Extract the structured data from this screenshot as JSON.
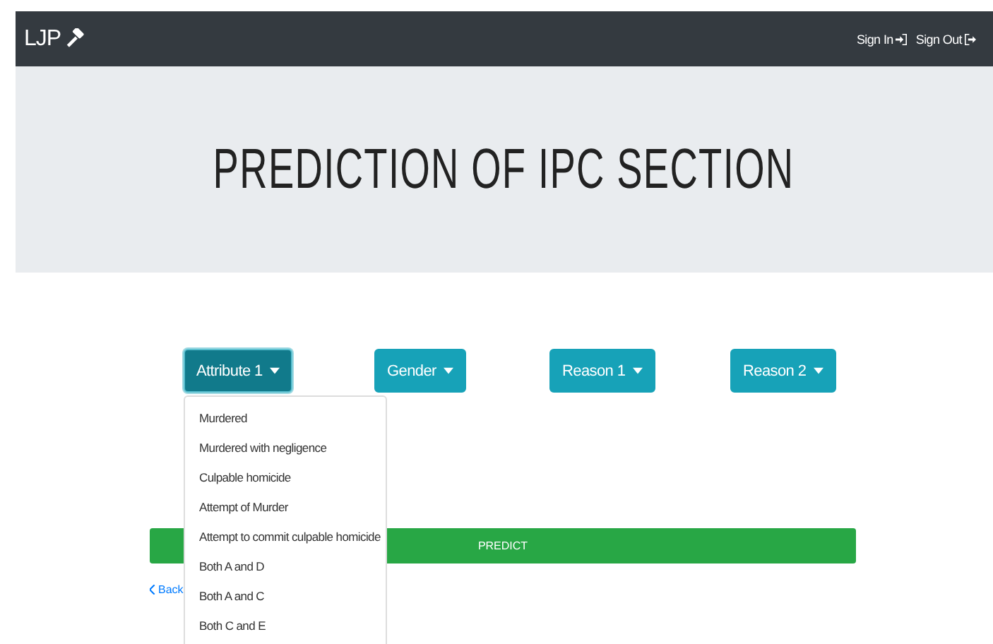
{
  "navbar": {
    "brand": "LJP",
    "links": [
      {
        "label": "Sign In",
        "kind": "signin"
      },
      {
        "label": "Sign Out",
        "kind": "signout"
      }
    ]
  },
  "jumbotron": {
    "title": "PREDICTION OF IPC SECTION"
  },
  "dropdowns": [
    {
      "label": "Attribute 1",
      "expanded": true,
      "items": [
        "Murdered",
        "Murdered with negligence",
        "Culpable homicide",
        "Attempt of Murder",
        "Attempt to commit culpable homicide",
        "Both A and D",
        "Both A and C",
        "Both C and E"
      ]
    },
    {
      "label": "Gender",
      "expanded": false
    },
    {
      "label": "Reason 1",
      "expanded": false
    },
    {
      "label": "Reason 2",
      "expanded": false
    }
  ],
  "predict_button": "PREDICT",
  "back_link": "Back"
}
